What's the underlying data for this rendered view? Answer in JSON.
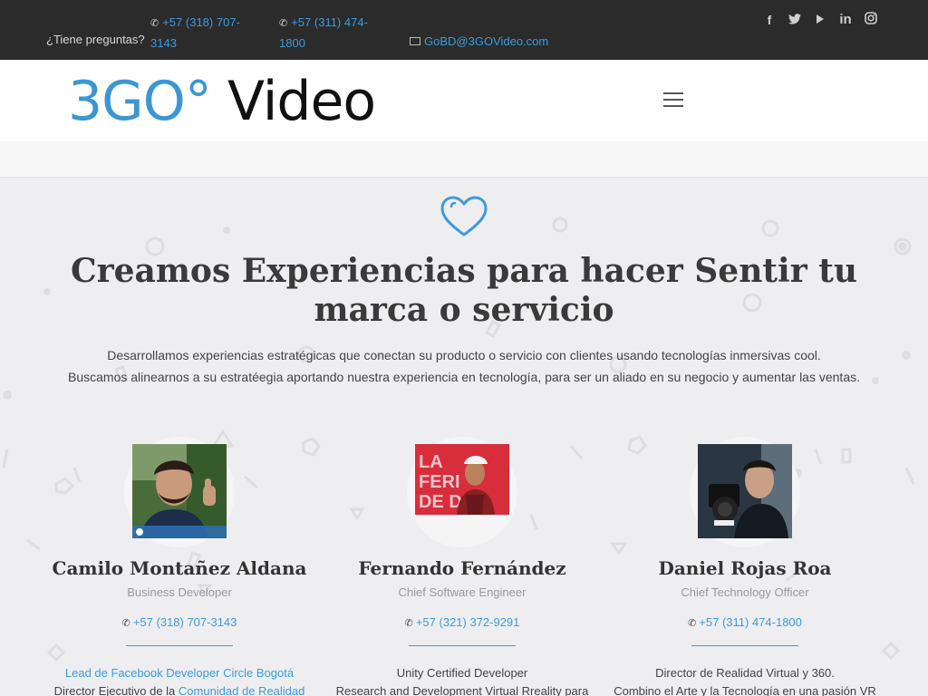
{
  "topbar": {
    "question": "¿Tiene preguntas?",
    "phone1": "+57 (318) 707-3143",
    "phone2": "+57 (311) 474-1800",
    "email": "GoBD@3GOVideo.com",
    "social_icons": [
      "facebook-icon",
      "twitter-icon",
      "youtube-icon",
      "linkedin-icon",
      "instagram-icon"
    ]
  },
  "header": {
    "logo_part1": "3GO°",
    "logo_part2": "Video"
  },
  "hero": {
    "icon": "heart-icon",
    "title": "Creamos Experiencias para hacer Sentir tu marca o servicio",
    "line1": "Desarrollamos experiencias estratégicas que conectan su producto o servicio con clientes usando tecnologías inmersivas cool.",
    "line2": "Buscamos alinearnos a su estratéegia aportando nuestra experiencia en tecnología, para ser un aliado en su negocio y aumentar las ventas."
  },
  "team": [
    {
      "name": "Camilo Montañez Aldana",
      "role": "Business Developer",
      "phone": "+57 (318) 707-3143",
      "bio_line1": "Lead de Facebook Developer Circle Bogotá",
      "bio_line2_prefix": "Director Ejecutivo de la ",
      "bio_line2_link": "Comunidad de Realidad",
      "photo_badge": "Developer Circles Member"
    },
    {
      "name": "Fernando Fernández",
      "role": "Chief Software Engineer",
      "phone": "+57 (321) 372-9291",
      "bio_line1": "Unity Certified Developer",
      "bio_line2": "Research and Development Virtual Rreality para",
      "photo_text": "LA FERI DE DI"
    },
    {
      "name": "Daniel Rojas Roa",
      "role": "Chief Technology Officer",
      "phone": "+57 (311) 474-1800",
      "bio_line1": "Director de Realidad Virtual y 360.",
      "bio_line2": "Combino el Arte y la Tecnología en una pasión VR"
    }
  ],
  "colors": {
    "accent": "#3b9be0",
    "topbar_bg": "#2b2b2b",
    "page_bg": "#eeeef0"
  }
}
